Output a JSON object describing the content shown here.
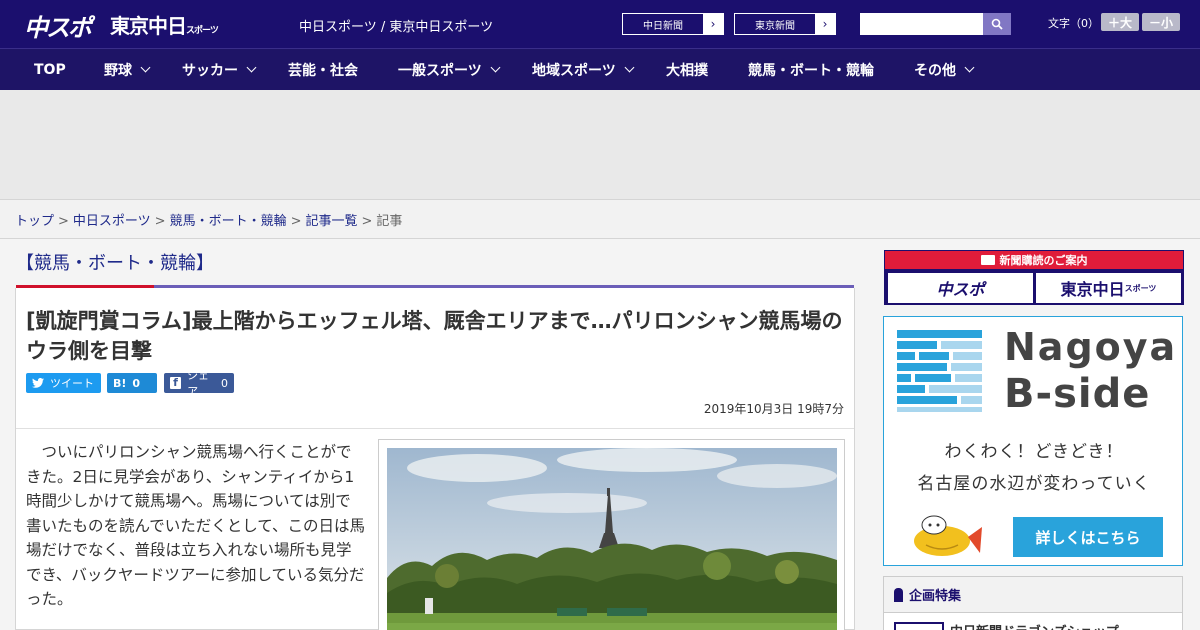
{
  "header": {
    "logo_chuspo": "中スポ",
    "logo_tokyo": "東京中日",
    "logo_tokyo_sub": "スポーツ",
    "site_title": "中日スポーツ / 東京中日スポーツ",
    "paper_buttons": [
      "中日新聞",
      "東京新聞"
    ],
    "search_placeholder": "",
    "fontsize_label": "文字（0）",
    "font_larger": "＋大",
    "font_smaller": "－小"
  },
  "nav": {
    "items": [
      {
        "label": "TOP",
        "dropdown": false
      },
      {
        "label": "野球",
        "dropdown": true
      },
      {
        "label": "サッカー",
        "dropdown": true
      },
      {
        "label": "芸能・社会",
        "dropdown": false
      },
      {
        "label": "一般スポーツ",
        "dropdown": true
      },
      {
        "label": "地域スポーツ",
        "dropdown": true
      },
      {
        "label": "大相撲",
        "dropdown": false
      },
      {
        "label": "競馬・ボート・競輪",
        "dropdown": false
      },
      {
        "label": "その他",
        "dropdown": true
      }
    ]
  },
  "breadcrumb": {
    "links": [
      "トップ",
      "中日スポーツ",
      "競馬・ボート・競輪",
      "記事一覧"
    ],
    "current": "記事"
  },
  "article": {
    "category": "【競馬・ボート・競輪】",
    "headline": "[凱旋門賞コラム]最上階からエッフェル塔、厩舎エリアまで…パリロンシャン競馬場のウラ側を目撃",
    "share_tweet": "ツイート",
    "share_hatena": "B!",
    "share_hatena_count": "0",
    "share_fb": "シェア",
    "share_fb_count": "0",
    "date": "2019年10月3日 19時7分",
    "body_p1": "ついにパリロンシャン競馬場へ行くことができた。2日に見学会があり、シャンティイから1時間少しかけて競馬場へ。馬場については別で書いたものを読んでいただくとして、この日は馬場だけでなく、普段は立ち入れない場所も見学でき、バックヤードツアーに参加している気分だった。"
  },
  "sidebar": {
    "subscription_title": "新聞購読のご案内",
    "sub_logo_1": "中スポ",
    "sub_logo_2": "東京中日",
    "sub_logo_2_small": "スポーツ",
    "banner_title1": "Nagoya",
    "banner_title2": "B-side",
    "banner_line1": "わくわく！どきどき！",
    "banner_line2": "名古屋の水辺が変わっていく",
    "banner_cta": "詳しくはこちら",
    "feature_title": "企画特集",
    "feature_item": "中日新聞ドラゴンズショップ"
  }
}
